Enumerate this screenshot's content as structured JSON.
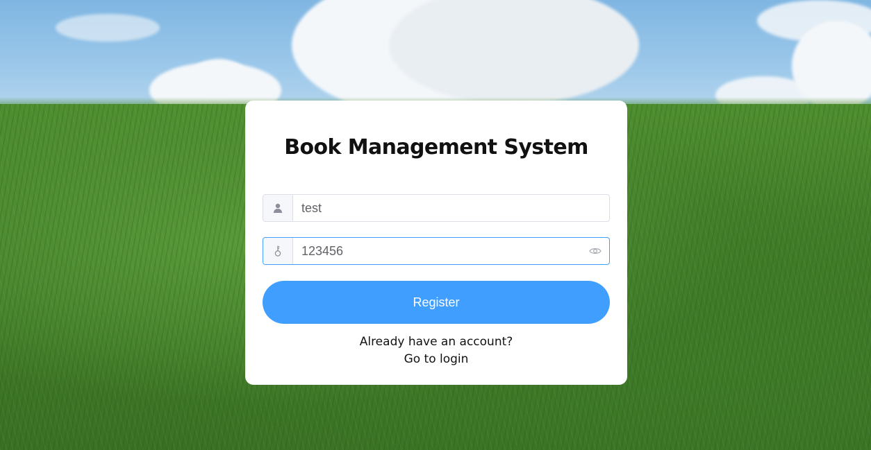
{
  "app": {
    "title": "Book Management System"
  },
  "form": {
    "username": {
      "value": "test",
      "icon": "user-icon"
    },
    "password": {
      "value": "123456",
      "icon": "key-icon",
      "toggle_icon": "eye-icon"
    },
    "submit_label": "Register"
  },
  "footer": {
    "prompt": "Already have an account?",
    "link_label": "Go to login"
  },
  "colors": {
    "primary": "#409eff",
    "card": "#ffffff",
    "focus_border": "#409eff"
  }
}
